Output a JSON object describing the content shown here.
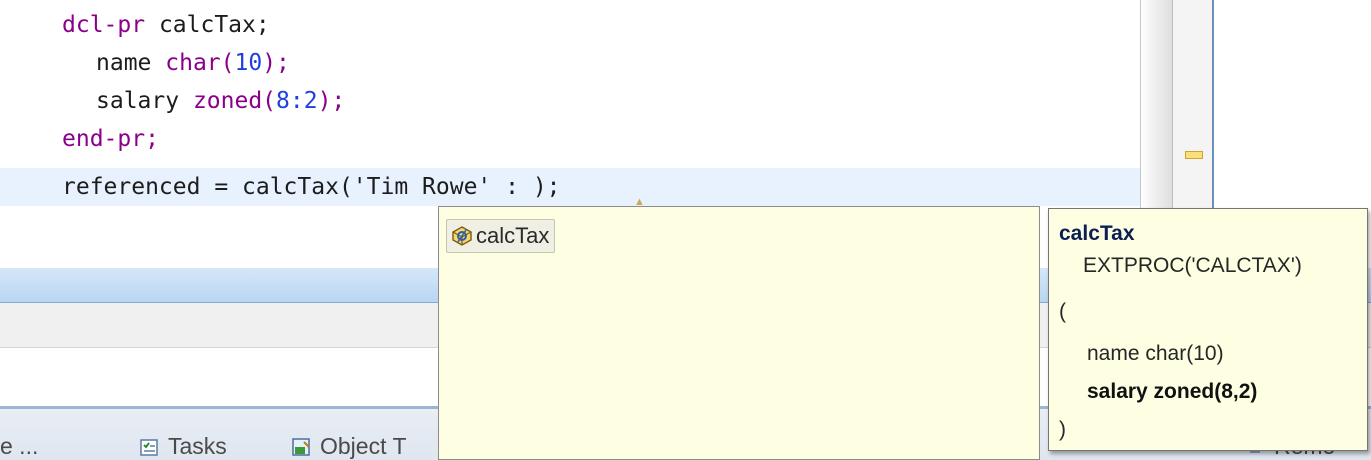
{
  "editor": {
    "lines": [
      {
        "kw": "dcl-pr",
        "rest": " calcTax;"
      },
      {
        "name": "name ",
        "type": "char(",
        "num": "10",
        "close": ");"
      },
      {
        "name": "salary ",
        "type": "zoned(",
        "num": "8:2",
        "close": ");"
      },
      {
        "kw": "end-pr;"
      },
      {
        "pre": "referenced = calcTax(",
        "str": "'Tim Rowe'",
        "post": " : );"
      }
    ]
  },
  "content_assist": {
    "item_label": "calcTax",
    "item_icon": "procedure-icon"
  },
  "tooltip": {
    "title": "calcTax",
    "extproc": "EXTPROC('CALCTAX')",
    "open_paren": "(",
    "param1": "name char(10)",
    "param2": "salary zoned(8,2)",
    "close_paren": ")"
  },
  "tabs": [
    {
      "label": "e ...",
      "icon": ""
    },
    {
      "label": "Tasks",
      "icon": "tasks-icon"
    },
    {
      "label": "Object T",
      "icon": "object-table-icon"
    },
    {
      "label": "Remo",
      "icon": "remote-icon"
    }
  ],
  "colors": {
    "keyword": "#8b008b",
    "number": "#1f3fe0",
    "current_line": "#e8f2fe",
    "popup_bg": "#fefee2"
  }
}
